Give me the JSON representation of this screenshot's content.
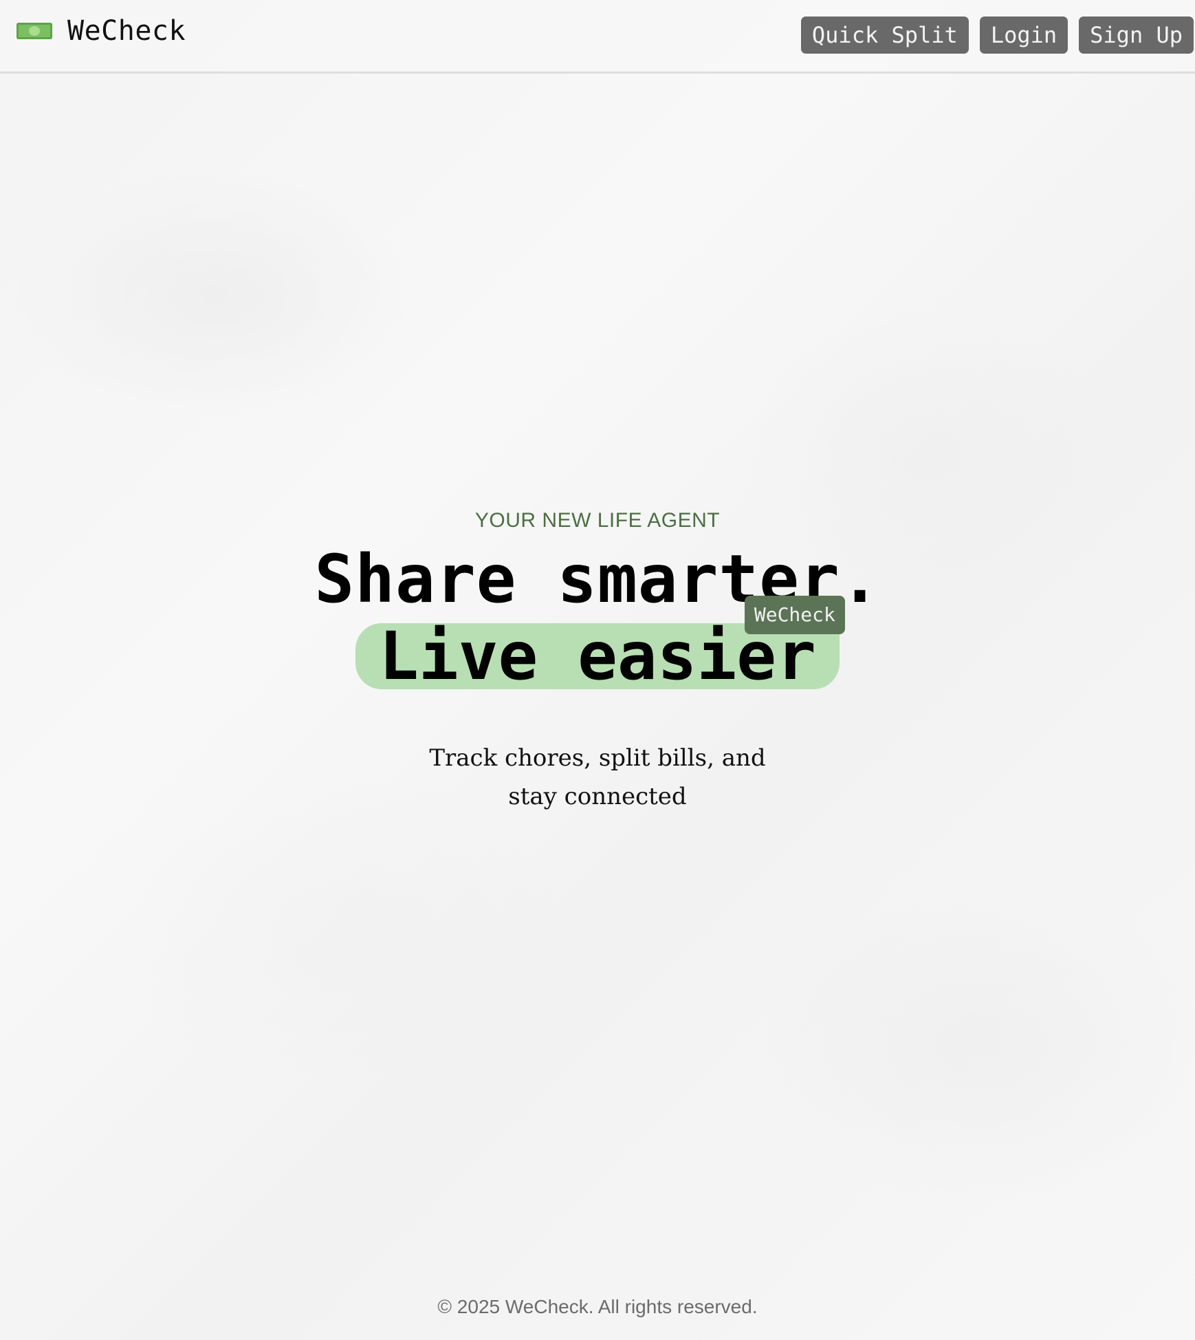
{
  "header": {
    "brand_icon": "money-bill-icon",
    "brand_name": "WeCheck",
    "nav": {
      "quick_split": "Quick Split",
      "login": "Login",
      "sign_up": "Sign Up"
    }
  },
  "hero": {
    "kicker": "YOUR NEW LIFE AGENT",
    "headline_line1": "Share smarter.",
    "headline_line2": "Live easier",
    "tag": "WeCheck",
    "subtitle": "Track chores, split bills, and stay connected"
  },
  "footer": {
    "copyright": "© 2025 WeCheck. All rights reserved."
  },
  "colors": {
    "accent_green": "#b8dfb3",
    "tag_green": "#5b7456",
    "kicker_green": "#4c6e43",
    "button_gray": "#696969"
  }
}
